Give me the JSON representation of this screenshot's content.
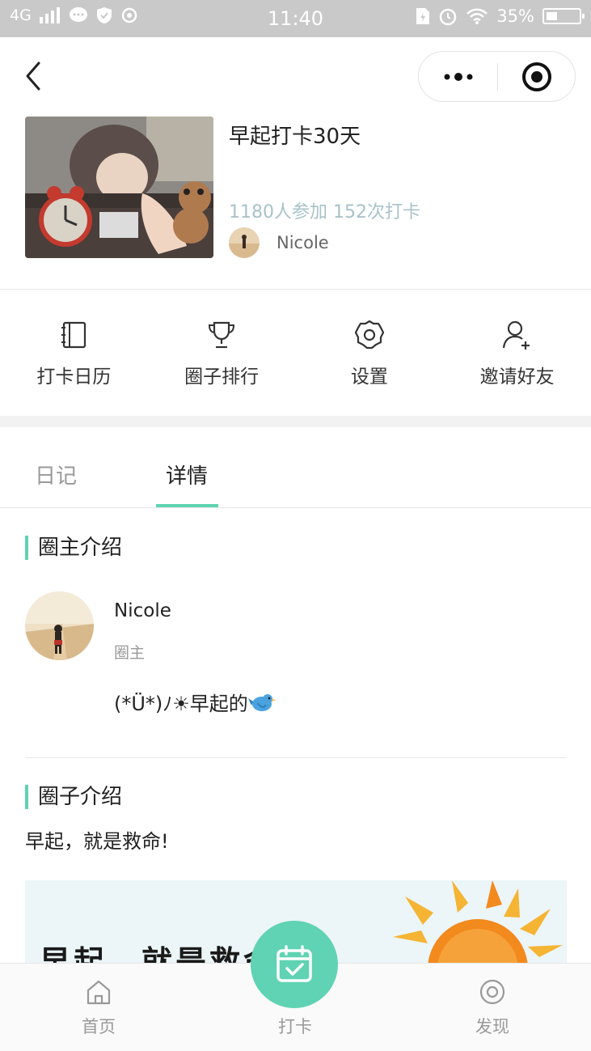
{
  "status_bar": {
    "network": "4G",
    "time": "11:40",
    "battery": "35%"
  },
  "circle": {
    "title": "早起打卡30天",
    "stats": "1180人参加 152次打卡",
    "owner_name": "Nicole"
  },
  "actions": [
    {
      "label": "打卡日历",
      "icon": "calendar-notebook-icon"
    },
    {
      "label": "圈子排行",
      "icon": "trophy-icon"
    },
    {
      "label": "设置",
      "icon": "gear-icon"
    },
    {
      "label": "邀请好友",
      "icon": "add-user-icon"
    }
  ],
  "tabs": {
    "diary": "日记",
    "detail": "详情",
    "active": "detail"
  },
  "owner_section": {
    "title": "圈主介绍",
    "name": "Nicole",
    "role": "圈主",
    "bio": "(*Ü*)ﾉ☀早起的"
  },
  "intro_section": {
    "title": "圈子介绍",
    "text": "早起，就是救命!",
    "banner_text": "早起，就是救命"
  },
  "tabbar": {
    "home": "首页",
    "checkin": "打卡",
    "discover": "发现"
  },
  "colors": {
    "accent": "#5fd3b3",
    "stats": "#a9c2c9",
    "status_bar": "#c9c9c9"
  }
}
